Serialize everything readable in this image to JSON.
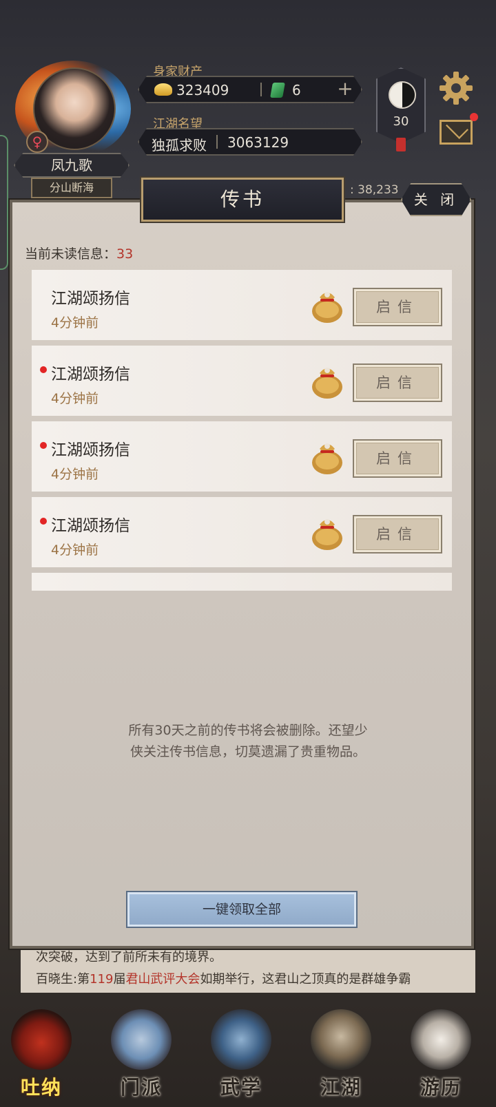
{
  "header": {
    "player_name": "凤九歌",
    "sect_name": "分山断海",
    "gender_symbol": "♀",
    "wealth_label": "身家财产",
    "gold_value": "323409",
    "jade_value": "6",
    "plus_symbol": "+",
    "fame_label": "江湖名望",
    "fame_title": "独孤求败",
    "fame_value": "3063129",
    "level": "30",
    "background_number": ": 38,233"
  },
  "modal": {
    "title": "传书",
    "close_label": "关 闭",
    "unread_label": "当前未读信息：",
    "unread_count": "33",
    "letters": [
      {
        "title": "江湖颂扬信",
        "time": "4分钟前",
        "unread": false,
        "button": "启信"
      },
      {
        "title": "江湖颂扬信",
        "time": "4分钟前",
        "unread": true,
        "button": "启信"
      },
      {
        "title": "江湖颂扬信",
        "time": "4分钟前",
        "unread": true,
        "button": "启信"
      },
      {
        "title": "江湖颂扬信",
        "time": "4分钟前",
        "unread": true,
        "button": "启信"
      }
    ],
    "notice_line1": "所有30天之前的传书将会被删除。还望少",
    "notice_line2": "侠关注传书信息，切莫遗漏了贵重物品。",
    "claim_all_label": "一键领取全部"
  },
  "ticker": {
    "line1": "次突破，达到了前所未有的境界。",
    "line2_a": "百晓生:第",
    "line2_num": "119",
    "line2_b": "届",
    "line2_event": "君山武评大会",
    "line2_c": "如期举行，这君山之顶真的是群雄争霸"
  },
  "nav": [
    {
      "label": "吐纳",
      "active": true
    },
    {
      "label": "门派",
      "active": false
    },
    {
      "label": "武学",
      "active": false
    },
    {
      "label": "江湖",
      "active": false
    },
    {
      "label": "游历",
      "active": false
    }
  ],
  "colors": {
    "accent_red": "#b3342a",
    "gold_text": "#c9a66c",
    "time_text": "#9c7446",
    "claim_button": "#a8c1dd"
  }
}
